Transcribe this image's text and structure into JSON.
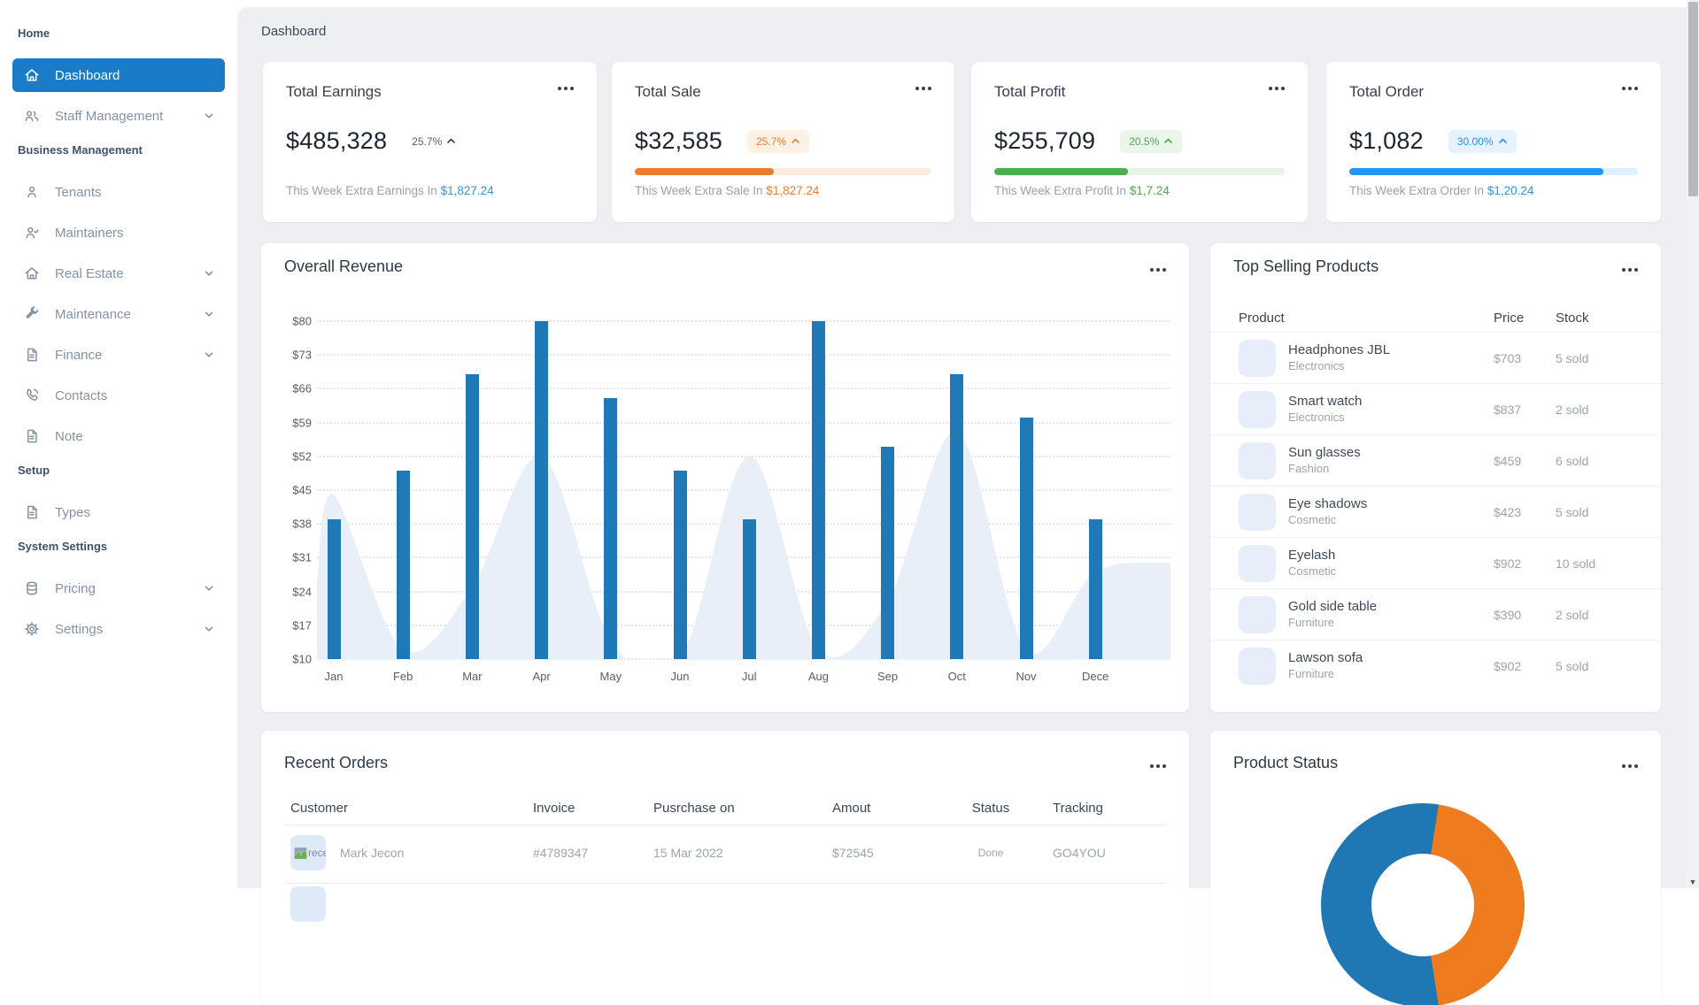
{
  "page": {
    "breadcrumb": "Dashboard"
  },
  "sidebar": {
    "sections": [
      {
        "label": "Home",
        "items": [
          {
            "label": "Dashboard",
            "icon": "home",
            "active": true
          },
          {
            "label": "Staff Management",
            "icon": "users",
            "chevron": true
          }
        ]
      },
      {
        "label": "Business Management",
        "items": [
          {
            "label": "Tenants",
            "icon": "person"
          },
          {
            "label": "Maintainers",
            "icon": "person-check"
          },
          {
            "label": "Real Estate",
            "icon": "home",
            "chevron": true
          },
          {
            "label": "Maintenance",
            "icon": "wrench",
            "chevron": true
          },
          {
            "label": "Finance",
            "icon": "document",
            "chevron": true
          },
          {
            "label": "Contacts",
            "icon": "phone"
          },
          {
            "label": "Note",
            "icon": "document"
          }
        ]
      },
      {
        "label": "Setup",
        "items": [
          {
            "label": "Types",
            "icon": "document"
          }
        ]
      },
      {
        "label": "System Settings",
        "items": [
          {
            "label": "Pricing",
            "icon": "database",
            "chevron": true
          },
          {
            "label": "Settings",
            "icon": "gear",
            "chevron": true
          }
        ]
      }
    ]
  },
  "stat_cards": [
    {
      "title": "Total Earnings",
      "value": "$485,328",
      "percent": "25.7%",
      "percent_style": "plain",
      "footer_label": "This Week Extra Earnings In",
      "footer_amount": "$1,827.24",
      "accent": "#3d8fd4"
    },
    {
      "title": "Total Sale",
      "value": "$32,585",
      "percent": "25.7%",
      "percent_style": "badge",
      "badge_bg": "#fdf1e6",
      "accent": "#ed7d2e",
      "progress_percent": 47,
      "track": "#fcecdd",
      "footer_label": "This Week Extra Sale In",
      "footer_amount": "$1,827.24"
    },
    {
      "title": "Total Profit",
      "value": "$255,709",
      "percent": "20.5%",
      "percent_style": "badge",
      "badge_bg": "#eaf6eb",
      "accent": "#4cac50",
      "progress_percent": 46,
      "track": "#e6f4e7",
      "footer_label": "This Week Extra Profit In",
      "footer_amount": "$1,7.24"
    },
    {
      "title": "Total Order",
      "value": "$1,082",
      "percent": "30.00%",
      "percent_style": "badge",
      "badge_bg": "#e6f2fe",
      "accent": "#2196f3",
      "progress_percent": 88,
      "track": "#dff0fd",
      "footer_label": "This Week Extra Order In",
      "footer_amount": "$1,20.24"
    }
  ],
  "chart_data": [
    {
      "type": "bar",
      "title": "Overall Revenue",
      "categories": [
        "Jan",
        "Feb",
        "Mar",
        "Apr",
        "May",
        "Jun",
        "Jul",
        "Aug",
        "Sep",
        "Oct",
        "Nov",
        "Dece"
      ],
      "values": [
        39,
        49,
        69,
        80,
        64,
        49,
        39,
        80,
        54,
        69,
        60,
        39
      ],
      "y_ticks": [
        "$80",
        "$73",
        "$66",
        "$59",
        "$52",
        "$45",
        "$38",
        "$31",
        "$24",
        "$17",
        "$10"
      ],
      "ylim": [
        10,
        80
      ],
      "grid": "horizontal-dotted",
      "bar_color": "#2079b7",
      "background_area_series": {
        "color": "#e9eff8",
        "values": [
          44,
          12,
          25,
          52,
          14,
          10,
          52,
          12,
          22,
          57,
          12,
          28
        ],
        "edge_start": 26,
        "edge_end": 30
      }
    },
    {
      "type": "pie",
      "title": "Product Status",
      "style": "donut, partially visible",
      "segments": [
        {
          "name": "segment-blue",
          "color": "#1f77b4",
          "approx_percent": 55
        },
        {
          "name": "segment-orange",
          "color": "#ee7c1e",
          "approx_percent": 45
        }
      ]
    }
  ],
  "top_products": {
    "title": "Top Selling Products",
    "columns": [
      "Product",
      "Price",
      "Stock"
    ],
    "rows": [
      {
        "name": "Headphones JBL",
        "category": "Electronics",
        "price": "$703",
        "stock": "5 sold"
      },
      {
        "name": "Smart watch",
        "category": "Electronics",
        "price": "$837",
        "stock": "2 sold"
      },
      {
        "name": "Sun glasses",
        "category": "Fashion",
        "price": "$459",
        "stock": "6 sold"
      },
      {
        "name": "Eye shadows",
        "category": "Cosmetic",
        "price": "$423",
        "stock": "5 sold"
      },
      {
        "name": "Eyelash",
        "category": "Cosmetic",
        "price": "$902",
        "stock": "10 sold"
      },
      {
        "name": "Gold side table",
        "category": "Furniture",
        "price": "$390",
        "stock": "2 sold"
      },
      {
        "name": "Lawson sofa",
        "category": "Furniture",
        "price": "$902",
        "stock": "5 sold"
      }
    ]
  },
  "recent_orders": {
    "title": "Recent Orders",
    "columns": [
      "Customer",
      "Invoice",
      "Pusrchase on",
      "Amout",
      "Status",
      "Tracking"
    ],
    "rows": [
      {
        "avatar_alt": "rece",
        "customer": "Mark Jecon",
        "invoice": "#4789347",
        "purchase_on": "15 Mar 2022",
        "amount": "$72545",
        "status": "Done",
        "tracking": "GO4YOU"
      }
    ],
    "partial_next_row_visible": true
  },
  "product_status": {
    "title": "Product Status"
  }
}
